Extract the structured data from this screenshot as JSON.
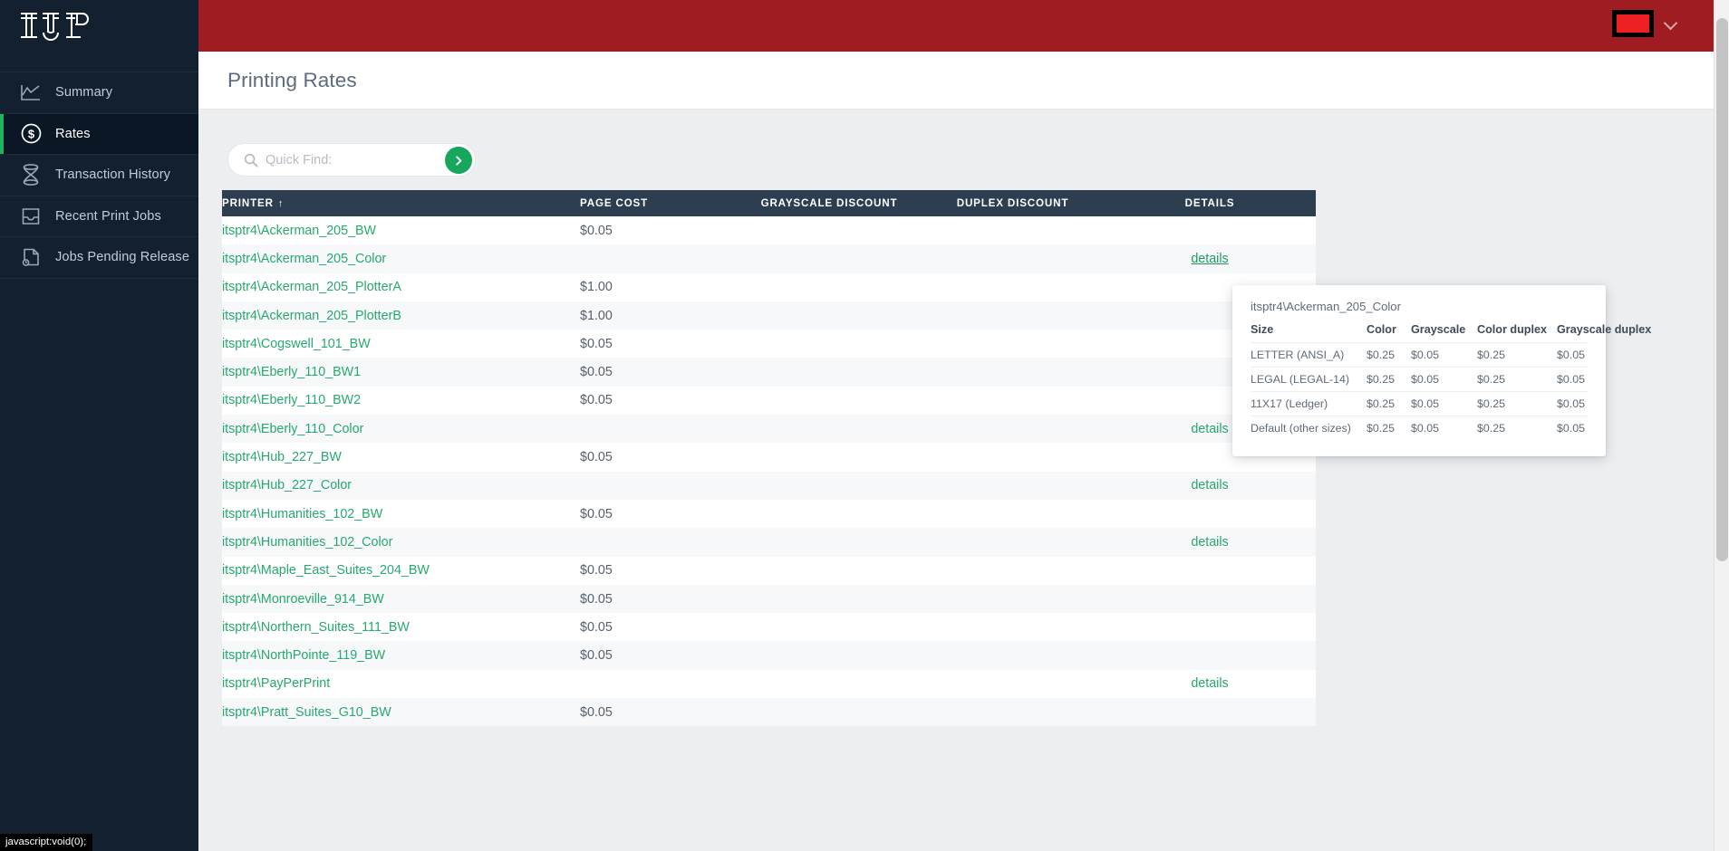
{
  "brand": {
    "logo_text": "IUP",
    "accent_green": "#21b360",
    "header_red": "#a01c23",
    "sidebar_dark": "#13202f",
    "link_green": "#26a96c",
    "table_header_navy": "#2c3e50"
  },
  "sidebar": {
    "items": [
      {
        "label": "Summary",
        "icon": "line-chart-icon",
        "active": false
      },
      {
        "label": "Rates",
        "icon": "dollar-circle-icon",
        "active": true
      },
      {
        "label": "Transaction History",
        "icon": "hourglass-icon",
        "active": false
      },
      {
        "label": "Recent Print Jobs",
        "icon": "printer-tray-icon",
        "active": false
      },
      {
        "label": "Jobs Pending Release",
        "icon": "document-clock-icon",
        "active": false
      }
    ]
  },
  "topbar": {
    "user_menu_icon": "redacted-username-box",
    "chevron_icon": "chevron-down-icon"
  },
  "header": {
    "title": "Printing Rates"
  },
  "search": {
    "placeholder": "Quick Find:",
    "value": "",
    "icon": "search-icon",
    "submit_icon": "chevron-right-icon"
  },
  "table": {
    "columns": [
      "PRINTER",
      "PAGE COST",
      "GRAYSCALE DISCOUNT",
      "DUPLEX DISCOUNT",
      "DETAILS"
    ],
    "sort_column": "PRINTER",
    "sort_arrow": "↑",
    "details_label": "details",
    "rows": [
      {
        "printer": "itsptr4\\Ackerman_205_BW",
        "page_cost": "$0.05",
        "grayscale_discount": "",
        "duplex_discount": "",
        "details": false
      },
      {
        "printer": "itsptr4\\Ackerman_205_Color",
        "page_cost": "",
        "grayscale_discount": "",
        "duplex_discount": "",
        "details": true,
        "hovered": true
      },
      {
        "printer": "itsptr4\\Ackerman_205_PlotterA",
        "page_cost": "$1.00",
        "grayscale_discount": "",
        "duplex_discount": "",
        "details": false
      },
      {
        "printer": "itsptr4\\Ackerman_205_PlotterB",
        "page_cost": "$1.00",
        "grayscale_discount": "",
        "duplex_discount": "",
        "details": false
      },
      {
        "printer": "itsptr4\\Cogswell_101_BW",
        "page_cost": "$0.05",
        "grayscale_discount": "",
        "duplex_discount": "",
        "details": false
      },
      {
        "printer": "itsptr4\\Eberly_110_BW1",
        "page_cost": "$0.05",
        "grayscale_discount": "",
        "duplex_discount": "",
        "details": false
      },
      {
        "printer": "itsptr4\\Eberly_110_BW2",
        "page_cost": "$0.05",
        "grayscale_discount": "",
        "duplex_discount": "",
        "details": false
      },
      {
        "printer": "itsptr4\\Eberly_110_Color",
        "page_cost": "",
        "grayscale_discount": "",
        "duplex_discount": "",
        "details": true
      },
      {
        "printer": "itsptr4\\Hub_227_BW",
        "page_cost": "$0.05",
        "grayscale_discount": "",
        "duplex_discount": "",
        "details": false
      },
      {
        "printer": "itsptr4\\Hub_227_Color",
        "page_cost": "",
        "grayscale_discount": "",
        "duplex_discount": "",
        "details": true
      },
      {
        "printer": "itsptr4\\Humanities_102_BW",
        "page_cost": "$0.05",
        "grayscale_discount": "",
        "duplex_discount": "",
        "details": false
      },
      {
        "printer": "itsptr4\\Humanities_102_Color",
        "page_cost": "",
        "grayscale_discount": "",
        "duplex_discount": "",
        "details": true
      },
      {
        "printer": "itsptr4\\Maple_East_Suites_204_BW",
        "page_cost": "$0.05",
        "grayscale_discount": "",
        "duplex_discount": "",
        "details": false
      },
      {
        "printer": "itsptr4\\Monroeville_914_BW",
        "page_cost": "$0.05",
        "grayscale_discount": "",
        "duplex_discount": "",
        "details": false
      },
      {
        "printer": "itsptr4\\Northern_Suites_111_BW",
        "page_cost": "$0.05",
        "grayscale_discount": "",
        "duplex_discount": "",
        "details": false
      },
      {
        "printer": "itsptr4\\NorthPointe_119_BW",
        "page_cost": "$0.05",
        "grayscale_discount": "",
        "duplex_discount": "",
        "details": false
      },
      {
        "printer": "itsptr4\\PayPerPrint",
        "page_cost": "",
        "grayscale_discount": "",
        "duplex_discount": "",
        "details": true
      },
      {
        "printer": "itsptr4\\Pratt_Suites_G10_BW",
        "page_cost": "$0.05",
        "grayscale_discount": "",
        "duplex_discount": "",
        "details": false
      }
    ]
  },
  "popover": {
    "title": "itsptr4\\Ackerman_205_Color",
    "columns": [
      "Size",
      "Color",
      "Grayscale",
      "Color duplex",
      "Grayscale duplex"
    ],
    "rows": [
      {
        "size": "LETTER (ANSI_A)",
        "color": "$0.25",
        "grayscale": "$0.05",
        "color_duplex": "$0.25",
        "grayscale_duplex": "$0.05"
      },
      {
        "size": "LEGAL (LEGAL-14)",
        "color": "$0.25",
        "grayscale": "$0.05",
        "color_duplex": "$0.25",
        "grayscale_duplex": "$0.05"
      },
      {
        "size": "11X17 (Ledger)",
        "color": "$0.25",
        "grayscale": "$0.05",
        "color_duplex": "$0.25",
        "grayscale_duplex": "$0.05"
      },
      {
        "size": "Default (other sizes)",
        "color": "$0.25",
        "grayscale": "$0.05",
        "color_duplex": "$0.25",
        "grayscale_duplex": "$0.05"
      }
    ]
  },
  "statusbar": {
    "text": "javascript:void(0);"
  }
}
